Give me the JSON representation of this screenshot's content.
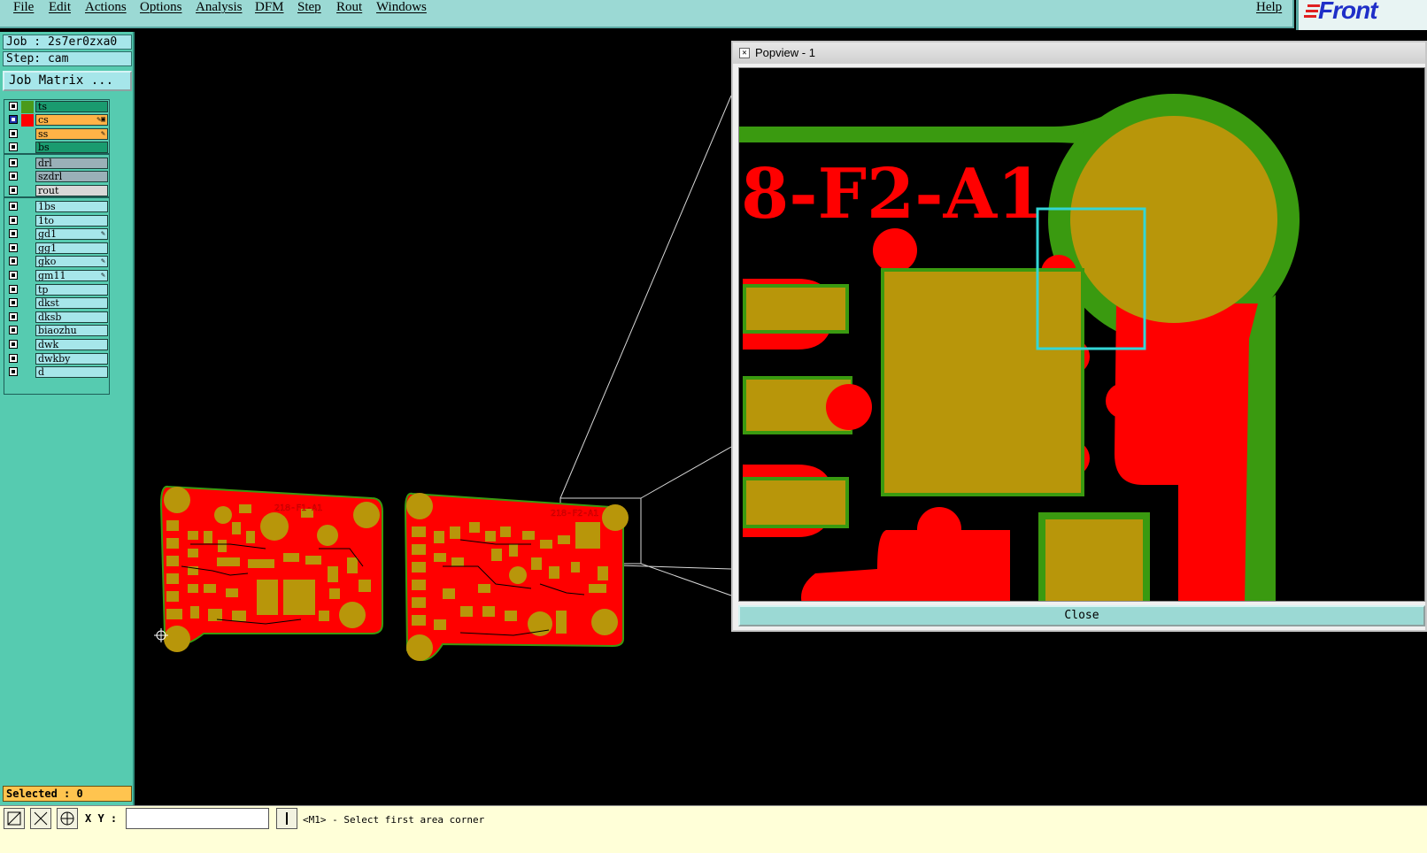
{
  "menubar": {
    "items": [
      "File",
      "Edit",
      "Actions",
      "Options",
      "Analysis",
      "DFM",
      "Step",
      "Rout",
      "Windows"
    ],
    "help": "Help",
    "logo": "Front"
  },
  "job": {
    "job_text": "Job : 2s7er0zxa0",
    "step_text": "Step: cam",
    "matrix_button": "Job Matrix ..."
  },
  "layers": [
    {
      "name": "ts",
      "color": "#4a9a1a",
      "fill": "#1a9b6f",
      "checked": false
    },
    {
      "name": "cs",
      "color": "#ff0000",
      "fill": "#ffb347",
      "checked": true,
      "marks": "✎▣"
    },
    {
      "name": "ss",
      "color": "#56cbb0",
      "fill": "#ffb347",
      "checked": false,
      "marks": "✎"
    },
    {
      "name": "bs",
      "color": "#56cbb0",
      "fill": "#1a9b6f",
      "checked": false
    },
    {
      "name": "drl",
      "color": "#56cbb0",
      "fill": "#9ab0b8",
      "checked": false
    },
    {
      "name": "szdrl",
      "color": "#56cbb0",
      "fill": "#9ab0b8",
      "checked": false
    },
    {
      "name": "rout",
      "color": "#56cbb0",
      "fill": "#d8d8d8",
      "checked": false
    },
    {
      "name": "1bs",
      "color": "#56cbb0",
      "fill": "#a6e6ea",
      "checked": false
    },
    {
      "name": "1to",
      "color": "#56cbb0",
      "fill": "#a6e6ea",
      "checked": false
    },
    {
      "name": "gd1",
      "color": "#56cbb0",
      "fill": "#a6e6ea",
      "checked": false,
      "marks": "✎"
    },
    {
      "name": "gg1",
      "color": "#56cbb0",
      "fill": "#a6e6ea",
      "checked": false
    },
    {
      "name": "gko",
      "color": "#56cbb0",
      "fill": "#a6e6ea",
      "checked": false,
      "marks": "✎"
    },
    {
      "name": "gm11",
      "color": "#56cbb0",
      "fill": "#a6e6ea",
      "checked": false,
      "marks": "✎"
    },
    {
      "name": "tp",
      "color": "#56cbb0",
      "fill": "#a6e6ea",
      "checked": false
    },
    {
      "name": "dkst",
      "color": "#56cbb0",
      "fill": "#a6e6ea",
      "checked": false
    },
    {
      "name": "dksb",
      "color": "#56cbb0",
      "fill": "#a6e6ea",
      "checked": false
    },
    {
      "name": "biaozhu",
      "color": "#56cbb0",
      "fill": "#a6e6ea",
      "checked": false
    },
    {
      "name": "dwk",
      "color": "#56cbb0",
      "fill": "#a6e6ea",
      "checked": false
    },
    {
      "name": "dwkby",
      "color": "#56cbb0",
      "fill": "#a6e6ea",
      "checked": false
    },
    {
      "name": "d",
      "color": "#56cbb0",
      "fill": "#a6e6ea",
      "checked": false
    }
  ],
  "selected": "Selected : 0",
  "status": {
    "xy_label": "X Y :",
    "xy_value": "",
    "prompt": "<M1> - Select first area corner"
  },
  "boards": [
    {
      "label": "218-F1-A1"
    },
    {
      "label": "218-F2-A1"
    }
  ],
  "popview": {
    "title": "Popview - 1",
    "close": "Close",
    "zoom_text": "8-F2-A1"
  },
  "colors": {
    "copper": "#ff0000",
    "pad": "#b8960a",
    "mask": "#3a9a10",
    "bg": "#000000"
  }
}
